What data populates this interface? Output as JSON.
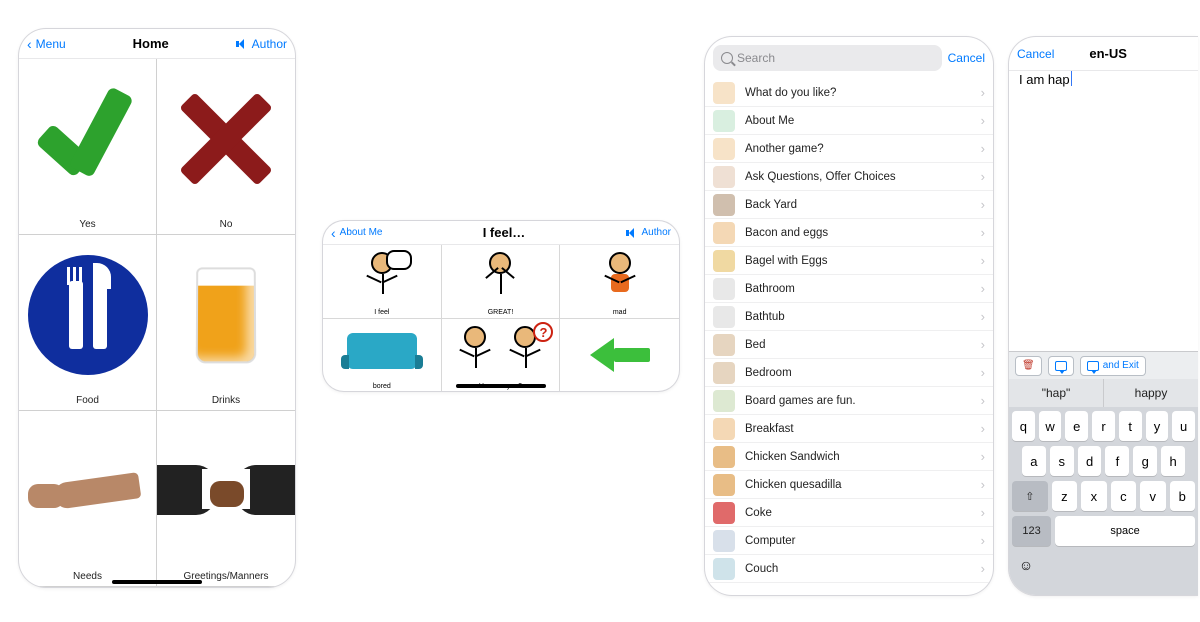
{
  "s1": {
    "back": "Menu",
    "title": "Home",
    "right": "Author",
    "cells": [
      {
        "label": "Yes",
        "icon": "check-icon"
      },
      {
        "label": "No",
        "icon": "cross-icon"
      },
      {
        "label": "Food",
        "icon": "plate-icon"
      },
      {
        "label": "Drinks",
        "icon": "glass-icon"
      },
      {
        "label": "Needs",
        "icon": "hand-icon"
      },
      {
        "label": "Greetings/Manners",
        "icon": "handshake-icon"
      }
    ]
  },
  "s2": {
    "back": "About Me",
    "title": "I feel…",
    "right": "Author",
    "cells": [
      {
        "label": "I feel"
      },
      {
        "label": "GREAT!"
      },
      {
        "label": "mad"
      },
      {
        "label": "bored"
      },
      {
        "label": "How are you?"
      },
      {
        "label": ""
      }
    ]
  },
  "s3": {
    "search_placeholder": "Search",
    "cancel": "Cancel",
    "items": [
      "What do you like?",
      "About Me",
      "Another game?",
      "Ask Questions, Offer Choices",
      "Back Yard",
      "Bacon and eggs",
      "Bagel with Eggs",
      "Bathroom",
      "Bathtub",
      "Bed",
      "Bedroom",
      "Board games are fun.",
      "Breakfast",
      "Chicken Sandwich",
      "Chicken quesadilla",
      "Coke",
      "Computer",
      "Couch"
    ]
  },
  "s4": {
    "cancel": "Cancel",
    "title": "en-US",
    "text": "I am hap",
    "toolbar": {
      "and_exit": "and Exit"
    },
    "suggestions": [
      "\"hap\"",
      "happy"
    ],
    "keys": {
      "r1": [
        "q",
        "w",
        "e",
        "r",
        "t",
        "y",
        "u"
      ],
      "r2": [
        "a",
        "s",
        "d",
        "f",
        "g",
        "h"
      ],
      "r3": [
        "z",
        "x",
        "c",
        "v",
        "b"
      ],
      "numkey": "123",
      "space": "space"
    }
  }
}
